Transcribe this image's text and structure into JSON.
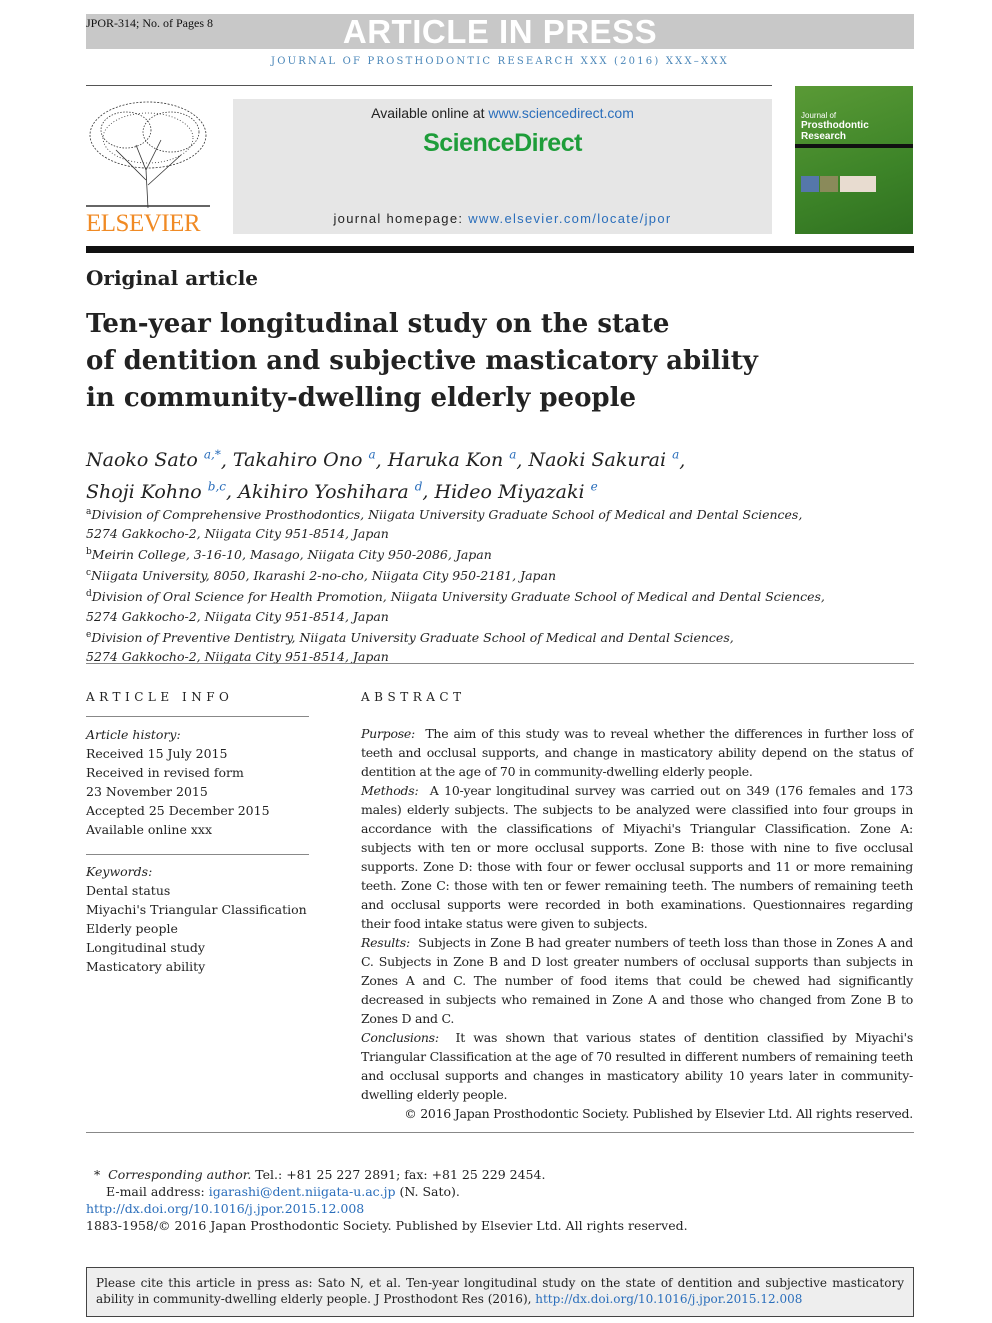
{
  "header": {
    "banner": "ARTICLE IN PRESS",
    "ref": "JPOR-314; No. of Pages 8",
    "journal_line": "JOURNAL OF PROSTHODONTIC RESEARCH XXX (2016) XXX–XXX"
  },
  "masthead": {
    "available_prefix": "Available online at ",
    "available_link": "www.sciencedirect.com",
    "sciencedirect": "ScienceDirect",
    "homepage_prefix": "journal homepage: ",
    "homepage_link": "www.elsevier.com/locate/jpor",
    "publisher_logo": "ELSEVIER",
    "cover_title": [
      "Journal of",
      "Prosthodontic",
      "Research"
    ]
  },
  "article": {
    "type": "Original article",
    "title_lines": [
      "Ten-year longitudinal study on the state",
      "of dentition and subjective masticatory ability",
      "in community-dwelling elderly people"
    ],
    "authors_line1": [
      {
        "name": "Naoko Sato",
        "sup": "a,*"
      },
      {
        "name": "Takahiro Ono",
        "sup": "a"
      },
      {
        "name": "Haruka Kon",
        "sup": "a"
      },
      {
        "name": "Naoki Sakurai",
        "sup": "a"
      }
    ],
    "authors_line2": [
      {
        "name": "Shoji Kohno",
        "sup": "b,c"
      },
      {
        "name": "Akihiro Yoshihara",
        "sup": "d"
      },
      {
        "name": "Hideo Miyazaki",
        "sup": "e"
      }
    ],
    "affiliations": [
      {
        "sup": "a",
        "lines": [
          "Division of Comprehensive Prosthodontics, Niigata University Graduate School of Medical and Dental Sciences,",
          "5274 Gakkocho-2, Niigata City 951-8514, Japan"
        ]
      },
      {
        "sup": "b",
        "lines": [
          "Meirin College, 3-16-10, Masago, Niigata City 950-2086, Japan"
        ]
      },
      {
        "sup": "c",
        "lines": [
          "Niigata University, 8050, Ikarashi 2-no-cho, Niigata City 950-2181, Japan"
        ]
      },
      {
        "sup": "d",
        "lines": [
          "Division of Oral Science for Health Promotion, Niigata University Graduate School of Medical and Dental Sciences,",
          "5274 Gakkocho-2, Niigata City 951-8514, Japan"
        ]
      },
      {
        "sup": "e",
        "lines": [
          "Division of Preventive Dentistry, Niigata University Graduate School of Medical and Dental Sciences,",
          "5274 Gakkocho-2, Niigata City 951-8514, Japan"
        ]
      }
    ]
  },
  "article_info": {
    "heading": "ARTICLE INFO",
    "history_label": "Article history:",
    "history": [
      "Received 15 July 2015",
      "Received in revised form",
      "23 November 2015",
      "Accepted 25 December 2015",
      "Available online xxx"
    ],
    "keywords_label": "Keywords:",
    "keywords": [
      "Dental status",
      "Miyachi's Triangular Classification",
      "Elderly people",
      "Longitudinal study",
      "Masticatory ability"
    ]
  },
  "abstract": {
    "heading": "ABSTRACT",
    "sections": [
      {
        "label": "Purpose:",
        "text": "The aim of this study was to reveal whether the differences in further loss of teeth and occlusal supports, and change in masticatory ability depend on the status of dentition at the age of 70 in community-dwelling elderly people."
      },
      {
        "label": "Methods:",
        "text": "A 10-year longitudinal survey was carried out on 349 (176 females and 173 males) elderly subjects. The subjects to be analyzed were classified into four groups in accordance with the classifications of Miyachi's Triangular Classification. Zone A: subjects with ten or more occlusal supports. Zone B: those with nine to five occlusal supports. Zone D: those with four or fewer occlusal supports and 11 or more remaining teeth. Zone C: those with ten or fewer remaining teeth. The numbers of remaining teeth and occlusal supports were recorded in both examinations. Questionnaires regarding their food intake status were given to subjects."
      },
      {
        "label": "Results:",
        "text": "Subjects in Zone B had greater numbers of teeth loss than those in Zones A and C. Subjects in Zone B and D lost greater numbers of occlusal supports than subjects in Zones A and C. The number of food items that could be chewed had significantly decreased in subjects who remained in Zone A and those who changed from Zone B to Zones D and C."
      },
      {
        "label": "Conclusions:",
        "text": "It was shown that various states of dentition classified by Miyachi's Triangular Classification at the age of 70 resulted in different numbers of remaining teeth and occlusal supports and changes in masticatory ability 10 years later in community-dwelling elderly people."
      }
    ],
    "copyright": "© 2016 Japan Prosthodontic Society. Published by Elsevier Ltd. All rights reserved."
  },
  "footnotes": {
    "corr_label": "Corresponding author.",
    "corr_text": " Tel.: +81 25 227 2891; fax: +81 25 229 2454.",
    "email_label": "E-mail address: ",
    "email": "igarashi@dent.niigata-u.ac.jp",
    "email_suffix": " (N. Sato).",
    "doi": "http://dx.doi.org/10.1016/j.jpor.2015.12.008",
    "issn": "1883-1958/© 2016 Japan Prosthodontic Society. Published by Elsevier Ltd. All rights reserved."
  },
  "cite_box": {
    "text": "Please cite this article in press as: Sato N, et al. Ten-year longitudinal study on the state of dentition and subjective masticatory ability in community-dwelling elderly people. J Prosthodont Res (2016), ",
    "link": "http://dx.doi.org/10.1016/j.jpor.2015.12.008"
  },
  "colors": {
    "link": "#2a6ebb",
    "sciencedirect": "#1e9d3a",
    "elsevier": "#f08a24",
    "cover": "#3d8428"
  }
}
